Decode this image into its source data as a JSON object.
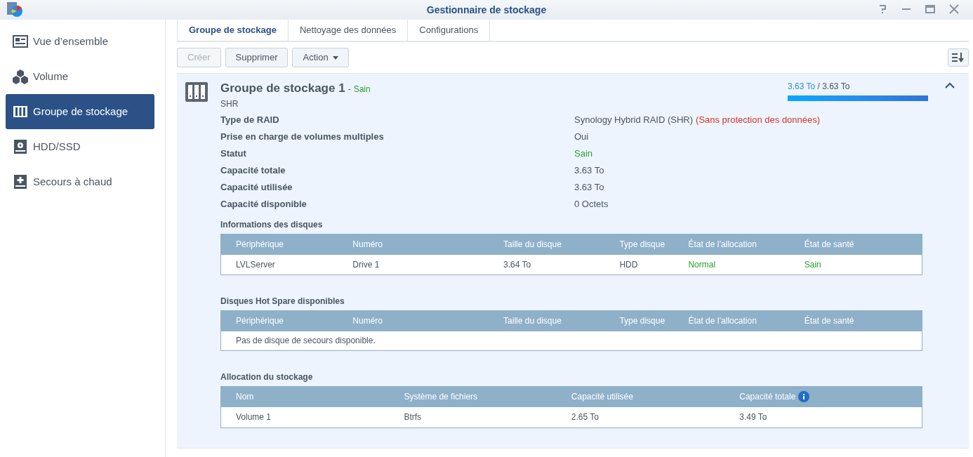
{
  "window": {
    "title": "Gestionnaire de stockage"
  },
  "sidebar": {
    "items": [
      {
        "label": "Vue d’ensemble",
        "selected": false
      },
      {
        "label": "Volume",
        "selected": false
      },
      {
        "label": "Groupe de stockage",
        "selected": true
      },
      {
        "label": "HDD/SSD",
        "selected": false
      },
      {
        "label": "Secours à chaud",
        "selected": false
      }
    ]
  },
  "tabs": [
    {
      "label": "Groupe de stockage",
      "selected": true
    },
    {
      "label": "Nettoyage des données",
      "selected": false
    },
    {
      "label": "Configurations",
      "selected": false
    }
  ],
  "toolbar": {
    "buttons": [
      {
        "label": "Créer",
        "disabled": true,
        "dropdown": false
      },
      {
        "label": "Supprimer",
        "disabled": false,
        "dropdown": false
      },
      {
        "label": "Action",
        "disabled": false,
        "dropdown": true
      }
    ]
  },
  "pools": [
    {
      "name": "Groupe de stockage 1",
      "separator": "-",
      "status": "Sain",
      "type": "SHR",
      "usage": "3.63 To",
      "total": " / 3.63 To",
      "level": 1,
      "expanded": true,
      "details": [
        {
          "label": "Type de RAID",
          "value": "Synology Hybrid RAID (SHR)",
          "warning": "(Sans protection des données)",
          "ok": false
        },
        {
          "label": "Prise en charge de volumes multiples",
          "value": "Oui",
          "ok": false
        },
        {
          "label": "Statut",
          "value": "Sain",
          "ok": true
        },
        {
          "label": "Capacité totale",
          "value": "3.63 To",
          "ok": false
        },
        {
          "label": "Capacité utilisée",
          "value": "3.63 To",
          "ok": false
        },
        {
          "label": "Capacité disponible",
          "value": "0 Octets",
          "ok": false
        }
      ],
      "disks": {
        "title": "Informations des disques",
        "columns": [
          "Périphérique",
          "Numéro",
          "Taille du disque",
          "Type disque",
          "État de l’allocation",
          "État de santé"
        ],
        "rows": [
          {
            "cells": [
              "LVLServer",
              "Drive 1",
              "3.64 To",
              "HDD",
              "Normal",
              "Sain"
            ]
          }
        ]
      },
      "hot_spares": {
        "title": "Disques Hot Spare disponibles",
        "columns": [
          "Périphérique",
          "Numéro",
          "Taille du disque",
          "Type disque",
          "État de l’allocation",
          "État de santé"
        ],
        "empty": "Pas de disque de secours disponible."
      },
      "allocation": {
        "title": "Allocation du stockage",
        "columns": [
          "Nom",
          "Système de fichiers",
          "Capacité utilisée",
          "Capacité totale"
        ],
        "rows": [
          {
            "cells": [
              "Volume 1",
              "Btrfs",
              "2.65 To",
              "3.49 To"
            ]
          }
        ]
      }
    }
  ]
}
